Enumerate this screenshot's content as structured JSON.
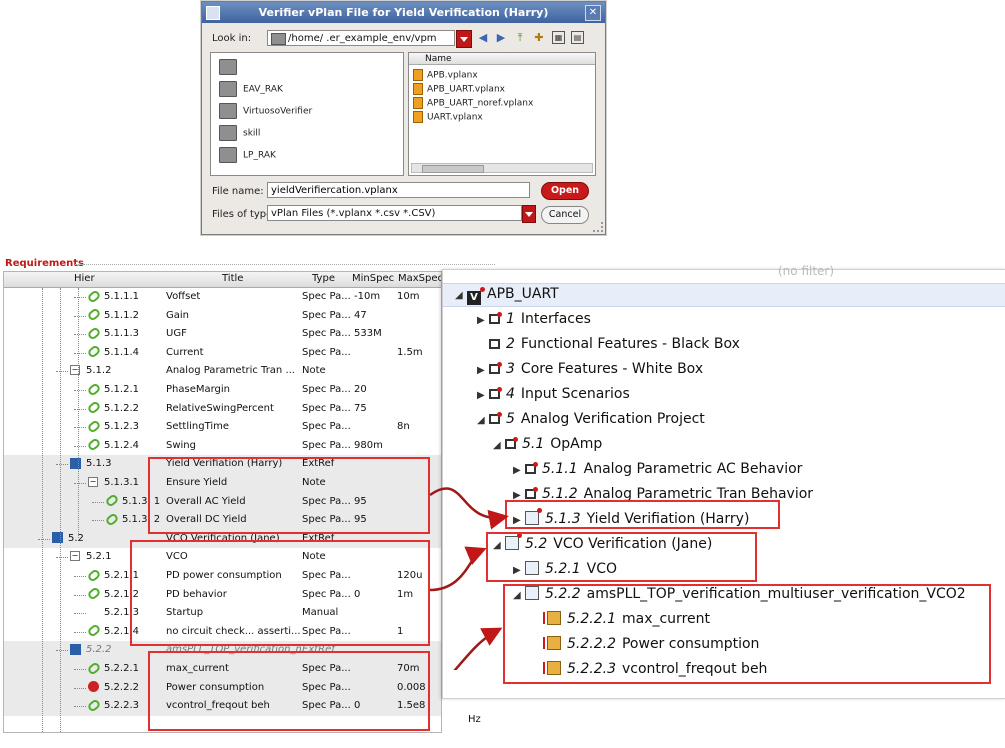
{
  "dialog": {
    "title": "Verifier vPlan File for Yield Verification (Harry)",
    "close_glyph": "✕",
    "look_in_label": "Look in:",
    "look_in_value": "/home/          .er_example_env/vpm",
    "folders": [
      "",
      "EAV_RAK",
      "VirtuosoVerifier",
      "skill",
      "LP_RAK"
    ],
    "files_header": "Name",
    "files": [
      "APB.vplanx",
      "APB_UART.vplanx",
      "APB_UART_noref.vplanx",
      "UART.vplanx"
    ],
    "file_name_label": "File name:",
    "file_name_value": "yieldVerifiercation.vplanx",
    "files_of_type_label": "Files of type:",
    "files_of_type_value": "vPlan Files (*.vplanx *.csv *.CSV)",
    "open_label": "Open",
    "cancel_label": "Cancel",
    "toolbar_icons": [
      "back-arrow-icon",
      "forward-arrow-icon",
      "parent-folder-icon",
      "new-folder-icon",
      "list-view-icon",
      "detail-view-icon"
    ]
  },
  "requirements": {
    "section_title": "Requirements",
    "columns": [
      "Hier",
      "Title",
      "Type",
      "MinSpec",
      "MaxSpec"
    ],
    "trailing_unit": "Hz",
    "rows": [
      {
        "hier": "5.1.1.1",
        "title": "Voffset",
        "type": "Spec Pa...",
        "min": "-10m",
        "max": "10m",
        "icon": "link",
        "level": 3
      },
      {
        "hier": "5.1.1.2",
        "title": "Gain",
        "type": "Spec Pa...",
        "min": "47",
        "max": "",
        "icon": "link",
        "level": 3
      },
      {
        "hier": "5.1.1.3",
        "title": "UGF",
        "type": "Spec Pa...",
        "min": "533M",
        "max": "",
        "icon": "link",
        "level": 3
      },
      {
        "hier": "5.1.1.4",
        "title": "Current",
        "type": "Spec Pa...",
        "min": "",
        "max": "1.5m",
        "icon": "link",
        "level": 3
      },
      {
        "hier": "5.1.2",
        "title": "Analog Parametric Tran ...",
        "type": "Note",
        "min": "",
        "max": "",
        "icon": "expander",
        "level": 2
      },
      {
        "hier": "5.1.2.1",
        "title": "PhaseMargin",
        "type": "Spec Pa...",
        "min": "20",
        "max": "",
        "icon": "link",
        "level": 3
      },
      {
        "hier": "5.1.2.2",
        "title": "RelativeSwingPercent",
        "type": "Spec Pa...",
        "min": "75",
        "max": "",
        "icon": "link",
        "level": 3
      },
      {
        "hier": "5.1.2.3",
        "title": "SettlingTime",
        "type": "Spec Pa...",
        "min": "",
        "max": "8n",
        "icon": "link",
        "level": 3
      },
      {
        "hier": "5.1.2.4",
        "title": "Swing",
        "type": "Spec Pa...",
        "min": "980m",
        "max": "",
        "icon": "link",
        "level": 3
      },
      {
        "hier": "5.1.3",
        "title": "Yield Verifiation (Harry)",
        "type": "ExtRef",
        "min": "",
        "max": "",
        "icon": "ext",
        "level": 2
      },
      {
        "hier": "5.1.3.1",
        "title": "Ensure Yield",
        "type": "Note",
        "min": "",
        "max": "",
        "icon": "expander",
        "level": 3
      },
      {
        "hier": "5.1.3.  1",
        "title": "Overall AC Yield",
        "type": "Spec Pa...",
        "min": "95",
        "max": "",
        "icon": "link",
        "level": 4
      },
      {
        "hier": "5.1.3.  2",
        "title": "Overall DC Yield",
        "type": "Spec Pa...",
        "min": "95",
        "max": "",
        "icon": "link",
        "level": 4
      },
      {
        "hier": "5.2",
        "title": "VCO Verification (Jane)",
        "type": "ExtRef",
        "min": "",
        "max": "",
        "icon": "ext",
        "level": 1
      },
      {
        "hier": "5.2.1",
        "title": "VCO",
        "type": "Note",
        "min": "",
        "max": "",
        "icon": "expander",
        "level": 2
      },
      {
        "hier": "5.2.1.1",
        "title": "PD power consumption",
        "type": "Spec Pa...",
        "min": "",
        "max": "120u",
        "icon": "link",
        "level": 3
      },
      {
        "hier": "5.2.1.2",
        "title": "PD behavior",
        "type": "Spec Pa...",
        "min": "0",
        "max": "1m",
        "icon": "link",
        "level": 3
      },
      {
        "hier": "5.2.1.3",
        "title": "Startup",
        "type": "Manual",
        "min": "",
        "max": "",
        "icon": "none",
        "level": 3
      },
      {
        "hier": "5.2.1.4",
        "title": "no circuit check... asserti...",
        "type": "Spec Pa...",
        "min": "",
        "max": "1",
        "icon": "link",
        "level": 3
      },
      {
        "hier": "5.2.2",
        "title": "amsPLL_TOP_verification_mu...",
        "type": "ExtRef",
        "min": "",
        "max": "",
        "icon": "ext",
        "level": 2,
        "italic": true
      },
      {
        "hier": "5.2.2.1",
        "title": "max_current",
        "type": "Spec Pa...",
        "min": "",
        "max": "70m",
        "icon": "link",
        "level": 3
      },
      {
        "hier": "5.2.2.2",
        "title": "Power consumption",
        "type": "Spec Pa...",
        "min": "",
        "max": "0.008",
        "icon": "stop",
        "level": 3
      },
      {
        "hier": "5.2.2.3",
        "title": "vcontrol_freqout beh",
        "type": "Spec Pa...",
        "min": "0",
        "max": "1.5e8",
        "icon": "link",
        "level": 3
      }
    ]
  },
  "tree": {
    "filter_text": "(no filter)",
    "items": [
      {
        "label": "APB_UART",
        "num": "",
        "indent": 0,
        "arrow": "▲",
        "icon": "v"
      },
      {
        "label": "Interfaces",
        "num": "1",
        "indent": 1,
        "arrow": "▶",
        "icon": "section-red"
      },
      {
        "label": "Functional Features - Black Box",
        "num": "2",
        "indent": 1,
        "arrow": "",
        "icon": "section"
      },
      {
        "label": "Core Features - White Box",
        "num": "3",
        "indent": 1,
        "arrow": "▶",
        "icon": "section-red"
      },
      {
        "label": "Input Scenarios",
        "num": "4",
        "indent": 1,
        "arrow": "▶",
        "icon": "section-red"
      },
      {
        "label": "Analog Verification Project",
        "num": "5",
        "indent": 1,
        "arrow": "▲",
        "icon": "section-red"
      },
      {
        "label": "OpAmp",
        "num": "5.1",
        "indent": 2,
        "arrow": "▲",
        "icon": "section-red"
      },
      {
        "label": "Analog Parametric AC Behavior",
        "num": "5.1.1",
        "indent": 3,
        "arrow": "▶",
        "icon": "section-red"
      },
      {
        "label": "Analog Parametric Tran Behavior",
        "num": "5.1.2",
        "indent": 3,
        "arrow": "▶",
        "icon": "section-red"
      },
      {
        "label": "Yield Verifiation (Harry)",
        "num": "5.1.3",
        "indent": 3,
        "arrow": "▶",
        "icon": "ext"
      },
      {
        "label": "VCO Verification (Jane)",
        "num": "5.2",
        "indent": 2,
        "arrow": "▲",
        "icon": "ext"
      },
      {
        "label": "VCO",
        "num": "5.2.1",
        "indent": 3,
        "arrow": "▶",
        "icon": "section-ext"
      },
      {
        "label": "amsPLL_TOP_verification_multiuser_verification_VCO2",
        "num": "5.2.2",
        "indent": 3,
        "arrow": "▲",
        "icon": "ext-blue"
      },
      {
        "label": "max_current",
        "num": "5.2.2.1",
        "indent": 4,
        "arrow": "",
        "icon": "spec"
      },
      {
        "label": "Power consumption",
        "num": "5.2.2.2",
        "indent": 4,
        "arrow": "",
        "icon": "spec"
      },
      {
        "label": "vcontrol_freqout beh",
        "num": "5.2.2.3",
        "indent": 4,
        "arrow": "",
        "icon": "spec"
      }
    ]
  },
  "colors": {
    "highlight": "#e03030",
    "title_bar": "#4f73ad",
    "link_green": "#4fae2c",
    "selected_row": "#e7eefa"
  }
}
